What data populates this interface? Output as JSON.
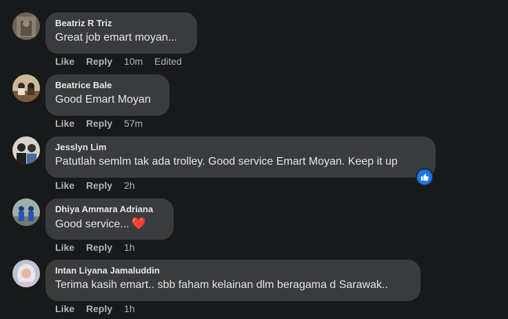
{
  "top_fragment": "reply",
  "comments": [
    {
      "name": "Beatriz R Triz",
      "text": "Great job emart moyan...",
      "actions": {
        "like": "Like",
        "reply": "Reply"
      },
      "time": "10m",
      "edited": "Edited"
    },
    {
      "name": "Beatrice Bale",
      "text": "Good Emart Moyan",
      "actions": {
        "like": "Like",
        "reply": "Reply"
      },
      "time": "57m"
    },
    {
      "name": "Jesslyn Lim",
      "text": "Patutlah semlm tak ada trolley. Good service Emart Moyan. Keep it up",
      "actions": {
        "like": "Like",
        "reply": "Reply"
      },
      "time": "2h",
      "reaction": "like-icon"
    },
    {
      "name": "Dhiya Ammara Adriana",
      "text": "Good service...",
      "emoji": "❤️",
      "actions": {
        "like": "Like",
        "reply": "Reply"
      },
      "time": "1h"
    },
    {
      "name": "Intan Liyana Jamaluddin",
      "text": "Terima kasih emart.. sbb faham kelainan dlm beragama d Sarawak..",
      "actions": {
        "like": "Like",
        "reply": "Reply"
      },
      "time": "1h"
    }
  ],
  "colors": {
    "background": "#18191a",
    "bubble": "#3a3b3c",
    "text": "#e4e6eb",
    "secondary": "#b0b3b8",
    "like_blue": "#1877f2",
    "heart": "#f02849"
  }
}
